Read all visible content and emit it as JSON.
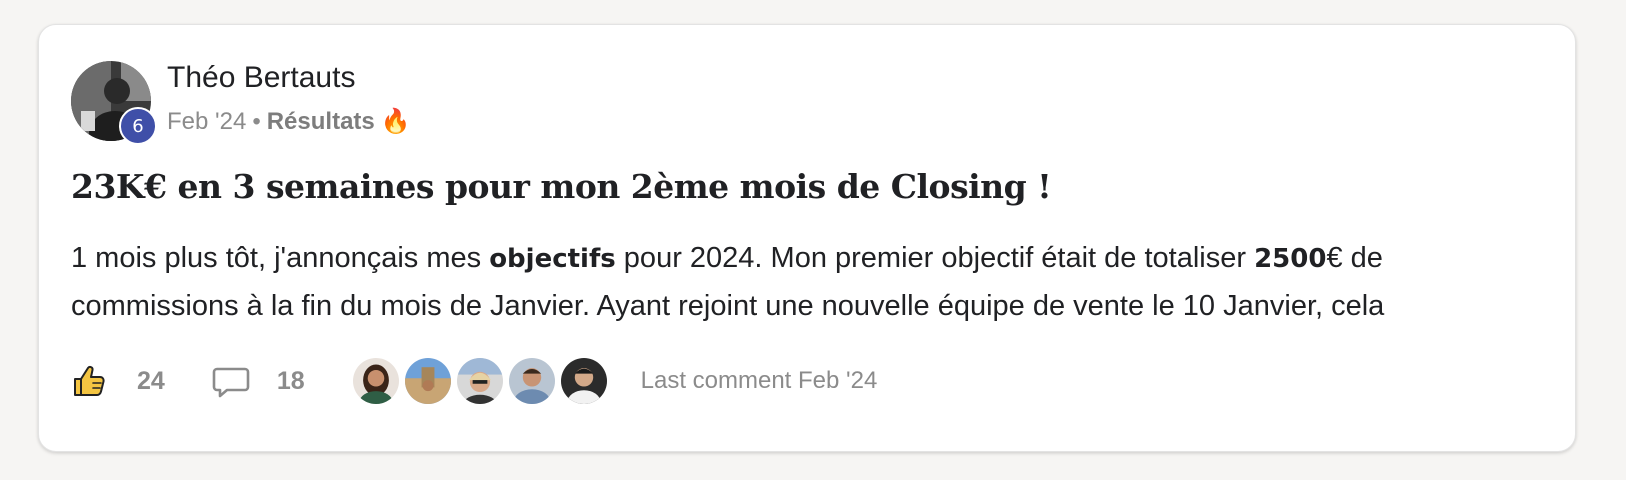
{
  "post": {
    "author": "Théo Bertauts",
    "level": "6",
    "date": "Feb '24",
    "separator": "•",
    "category": "Résultats",
    "category_emoji": "🔥",
    "title": "23K€ en 3 semaines pour mon 2ème mois de Closing !",
    "body": {
      "p1": "1 mois plus tôt, j'annonçais mes ",
      "b1": "objectifs",
      "p2": " pour 2024. Mon premier objectif était de totaliser ",
      "b2": "2500",
      "p3": "€ de commissions à la fin du mois de Janvier. Ayant rejoint une nouvelle équipe de vente le 10 Janvier, cela"
    }
  },
  "footer": {
    "likes": "24",
    "comments": "18",
    "last_comment": "Last comment Feb '24",
    "icons": {
      "like": "thumbs-up-icon",
      "comment": "comment-bubble-icon"
    },
    "colors": {
      "like_fill": "#f4c542",
      "level_badge": "#3f4fa8"
    }
  }
}
